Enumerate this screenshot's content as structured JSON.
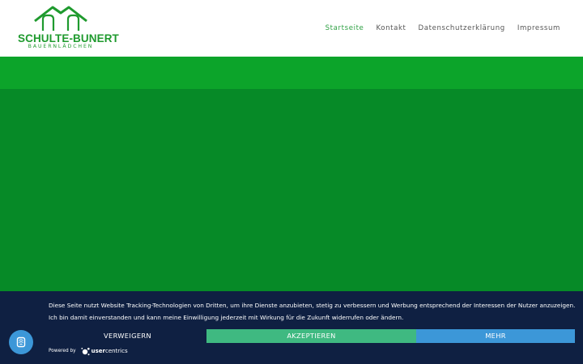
{
  "logo": {
    "name": "SCHULTE-BUNERT",
    "tagline": "BAUERNLÄDCHEN",
    "icon": "barn-roof-icon"
  },
  "nav": {
    "items": [
      {
        "label": "Startseite",
        "active": true
      },
      {
        "label": "Kontakt",
        "active": false
      },
      {
        "label": "Datenschutzerklärung",
        "active": false
      },
      {
        "label": "Impressum",
        "active": false
      }
    ]
  },
  "colors": {
    "brand_green": "#1f9a2e",
    "hero_light": "#0ca42a",
    "hero_dark": "#068a27",
    "banner_bg": "#0f2042",
    "accept": "#3fb981",
    "more": "#3c97d8"
  },
  "cookie": {
    "text": "Diese Seite nutzt Website Tracking-Technologien von Dritten, um ihre Dienste anzubieten, stetig zu verbessern und Werbung entsprechend der Interessen der Nutzer anzuzeigen. Ich bin damit einverstanden und kann meine Einwilligung jederzeit mit Wirkung für die Zukunft widerrufen oder ändern.",
    "deny_label": "VERWEIGERN",
    "accept_label": "AKZEPTIEREN",
    "more_label": "MEHR",
    "powered_label": "Powered by",
    "brand_user": "user",
    "brand_centrics": "centrics"
  },
  "privacy_button": {
    "icon": "fingerprint-icon"
  }
}
